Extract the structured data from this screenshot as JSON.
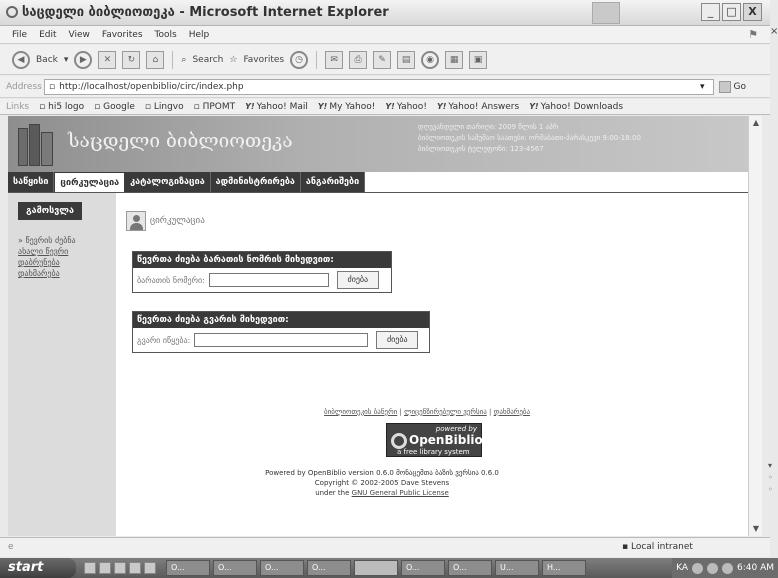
{
  "window": {
    "title": "საცდელი ბიბლიოთეკა - Microsoft Internet Explorer",
    "controls": [
      "_",
      "□",
      "X"
    ],
    "side_close": "×"
  },
  "menu": [
    "File",
    "Edit",
    "View",
    "Favorites",
    "Tools",
    "Help"
  ],
  "toolbar": {
    "back": "Back",
    "search": "Search",
    "favorites": "Favorites"
  },
  "address": {
    "label": "Address",
    "url": "http://localhost/openbiblio/circ/index.php",
    "go": "Go"
  },
  "links": {
    "label": "Links",
    "items": [
      "hi5 logo",
      "Google",
      "Lingvo",
      "ПРОМТ",
      "Yahoo! Mail",
      "My Yahoo!",
      "Yahoo!",
      "Yahoo! Answers",
      "Yahoo! Downloads"
    ],
    "yahoo_mark": "Y!"
  },
  "page": {
    "library_name": "საცდელი ბიბლიოთეკა",
    "info_lines": [
      "დღევანდელი თარიღი: 2009 წლის 1 აპრ",
      "ბიბლიოთეკის სამუშაო საათები: ორშაბათი-პარასკევი 9:00-18:00",
      "ბიბლიოთეკის ტელეფონი: 123-4567"
    ],
    "tabs": [
      "საწყისი",
      "ცირკულაცია",
      "კატალოგიზაცია",
      "ადმინისტრირება",
      "ანგარიშები"
    ],
    "active_tab": 1,
    "sidebar": {
      "logout": "გამოსვლა",
      "links": [
        "» წევრის ძებნა",
        "ახალი წევრი",
        "დაბრუნება",
        "დახმარება"
      ]
    },
    "heading": "ცირკულაცია",
    "form1": {
      "title": "წევრთა ძიება ბარათის ნომრის მიხედვით:",
      "label": "ბარათის ნომერი:",
      "button": "ძიება"
    },
    "form2": {
      "title": "წევრთა ძიება გვარის მიხედვით:",
      "label": "გვარი იწყება:",
      "button": "ძიება"
    },
    "footer": {
      "links": [
        "ბიბლიოთეკის ბანერი",
        "ლიცენზირებული ვერსია",
        "დახმარება"
      ],
      "sep": "|",
      "badge_powered": "powered by",
      "badge_name": "OpenBiblio",
      "badge_sub": "a free library system",
      "powered_line": "Powered by OpenBiblio version 0.6.0 მონაცემთა ბაზის ვერსია 0.6.0",
      "copyright_line": "Copyright © 2002-2005 Dave Stevens",
      "license_prefix": "under the",
      "license_link": "GNU General Public License"
    }
  },
  "statusbar": {
    "left": "e",
    "zone": "Local intranet"
  },
  "taskbar": {
    "start": "start",
    "tasks": [
      "O...",
      "O...",
      "O...",
      "O...",
      "",
      "O...",
      "O...",
      "U...",
      "H..."
    ],
    "active_task": 4,
    "lang": "KA",
    "clock": "6:40 AM"
  }
}
